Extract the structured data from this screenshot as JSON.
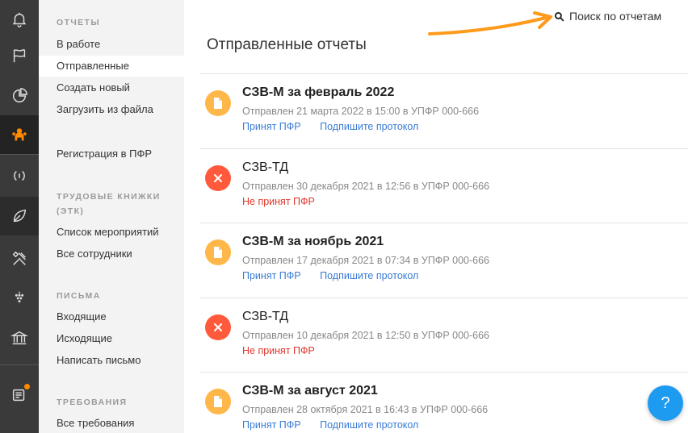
{
  "sidebar": {
    "section_reports": "ОТЧЕТЫ",
    "in_work": "В работе",
    "sent": "Отправленные",
    "create_new": "Создать новый",
    "upload_file": "Загрузить из файла",
    "pfr_registration": "Регистрация в ПФР",
    "section_etk": "ТРУДОВЫЕ КНИЖКИ",
    "section_etk2": "(ЭТК)",
    "events_list": "Список мероприятий",
    "all_employees": "Все сотрудники",
    "section_letters": "ПИСЬМА",
    "incoming": "Входящие",
    "outgoing": "Исходящие",
    "write_letter": "Написать письмо",
    "section_requirements": "ТРЕБОВАНИЯ",
    "all_requirements": "Все требования"
  },
  "main": {
    "title": "Отправленные отчеты",
    "search_label": "Поиск по отчетам",
    "help_label": "?"
  },
  "reports": [
    {
      "title": "СЗВ-М за февраль 2022",
      "sub": "Отправлен 21 марта 2022 в 15:00 в УПФР 000-666",
      "status": "Принят ПФР",
      "action": "Подпишите протокол"
    },
    {
      "title": "СЗВ-ТД",
      "sub": "Отправлен 30 декабря 2021 в 12:56 в УПФР 000-666",
      "status": "Не принят ПФР"
    },
    {
      "title": "СЗВ-М за ноябрь 2021",
      "sub": "Отправлен 17 декабря 2021 в 07:34 в УПФР 000-666",
      "status": "Принят ПФР",
      "action": "Подпишите протокол"
    },
    {
      "title": "СЗВ-ТД",
      "sub": "Отправлен 10 декабря 2021 в 12:50 в УПФР 000-666",
      "status": "Не принят ПФР"
    },
    {
      "title": "СЗВ-М за август 2021",
      "sub": "Отправлен 28 октября 2021 в 16:43 в УПФР 000-666",
      "status": "Принят ПФР",
      "action": "Подпишите протокол"
    }
  ],
  "colors": {
    "accent_orange": "#ff8a00",
    "ok_icon": "#ffb74a",
    "error_icon": "#ff5a3c",
    "link": "#3a7bd5",
    "error_text": "#e0362b",
    "help_button": "#1d9bf0"
  },
  "icons": [
    "bell-icon",
    "flag-icon",
    "pie-chart-icon",
    "people-icon",
    "sound-icon",
    "leaf-icon",
    "tools-icon",
    "grapes-icon",
    "bank-icon",
    "news-icon",
    "document-icon",
    "close-icon",
    "search-icon",
    "arrow-annotation"
  ]
}
